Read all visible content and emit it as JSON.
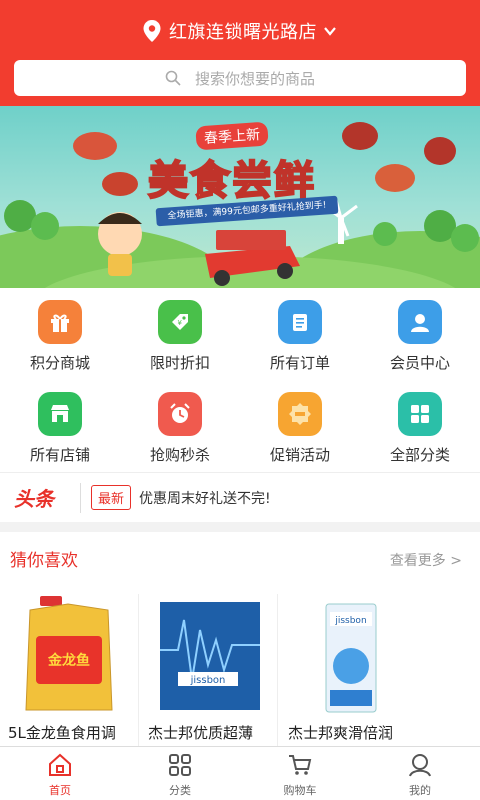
{
  "header": {
    "store_name": "红旗连锁曙光路店",
    "search_placeholder": "搜索你想要的商品"
  },
  "banner": {
    "subtitle": "春季上新",
    "title": "美食尝鲜",
    "ribbon": "全场钜惠，满99元包邮多重好礼抢到手!"
  },
  "grid": [
    {
      "label": "积分商城",
      "icon": "gift-icon",
      "color": "#f5813a"
    },
    {
      "label": "限时折扣",
      "icon": "discount-tag-icon",
      "color": "#49c04a"
    },
    {
      "label": "所有订单",
      "icon": "orders-list-icon",
      "color": "#3d9ee8"
    },
    {
      "label": "会员中心",
      "icon": "member-icon",
      "color": "#3d9ee8"
    },
    {
      "label": "所有店铺",
      "icon": "store-icon",
      "color": "#2fbf5e"
    },
    {
      "label": "抢购秒杀",
      "icon": "alarm-clock-icon",
      "color": "#f05a4e"
    },
    {
      "label": "促销活动",
      "icon": "promo-badge-icon",
      "color": "#f7a531"
    },
    {
      "label": "全部分类",
      "icon": "category-grid-icon",
      "color": "#2bbfa8"
    }
  ],
  "news": {
    "logo": "头条",
    "tag": "最新",
    "text": "优惠周末好礼送不完!"
  },
  "recommend": {
    "title": "猜你喜欢",
    "more": "查看更多 >",
    "products": [
      {
        "name": "5L金龙鱼食用调"
      },
      {
        "name": "杰士邦优质超薄"
      },
      {
        "name": "杰士邦爽滑倍润"
      }
    ]
  },
  "tabbar": [
    {
      "label": "首页",
      "icon": "home-icon",
      "active": true
    },
    {
      "label": "分类",
      "icon": "category-icon",
      "active": false
    },
    {
      "label": "购物车",
      "icon": "cart-icon",
      "active": false
    },
    {
      "label": "我的",
      "icon": "profile-icon",
      "active": false
    }
  ],
  "colors": {
    "brand_red": "#f23d2f",
    "accent_red": "#e8312a"
  }
}
